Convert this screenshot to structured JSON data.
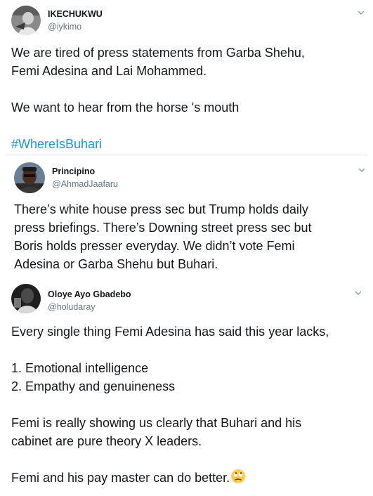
{
  "tweets": [
    {
      "name": "IKECHUKWU",
      "handle": "@iykimo",
      "text": "We are tired of press statements from Garba Shehu,\nFemi Adesina and Lai Mohammed.\n\nWe want to hear from the horse 's mouth",
      "hashtag": "#WhereIsBuhari"
    },
    {
      "name": "Principino",
      "handle": "@AhmadJaafaru",
      "text": "There’s white house press sec but Trump holds daily\npress briefings. There’s Downing street press sec but\nBoris holds presser everyday. We didn’t vote Femi\nAdesina or Garba Shehu but Buhari."
    },
    {
      "name": "Oloye Ayo Gbadebo",
      "handle": "@holudaray",
      "text": "Every single thing Femi Adesina has said this year lacks,\n\n1. Emotional intelligence\n2. Empathy and genuineness\n\nFemi is really showing us clearly that Buhari and his\ncabinet are pure theory X leaders.\n\nFemi and his pay master can do better.",
      "emoji_icon": "face-with-rolling-eyes-emoji"
    }
  ],
  "colors": {
    "text": "#14171a",
    "secondary": "#657786",
    "link": "#1b95e0",
    "divider": "#e1e8ed"
  },
  "icons": {
    "menu": "chevron-down-icon"
  }
}
